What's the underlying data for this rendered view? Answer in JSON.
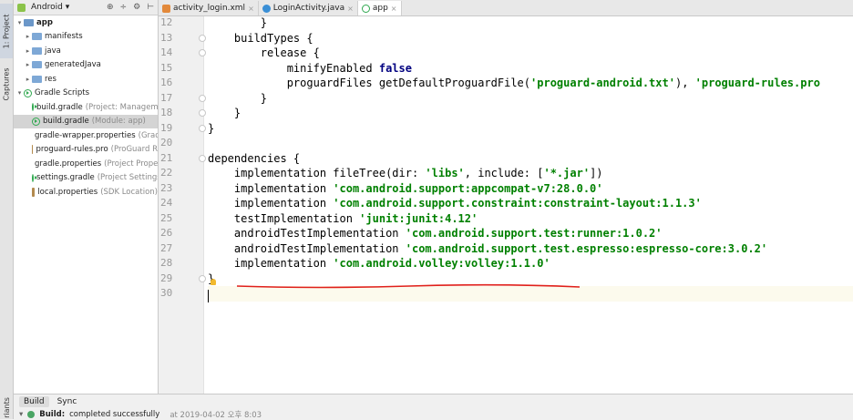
{
  "toolstrip": {
    "project_tab": "1: Project",
    "captures_tab": "Captures",
    "variants_tab": "riants"
  },
  "project_panel": {
    "view_selector": "Android",
    "tree": [
      {
        "label": "app",
        "secondary": "",
        "type": "folder-app",
        "arrow": "▾",
        "indent": 0,
        "selected": false,
        "bold": true
      },
      {
        "label": "manifests",
        "secondary": "",
        "type": "folder",
        "arrow": "▸",
        "indent": 1,
        "selected": false,
        "bold": false
      },
      {
        "label": "java",
        "secondary": "",
        "type": "folder",
        "arrow": "▸",
        "indent": 1,
        "selected": false,
        "bold": false
      },
      {
        "label": "generatedJava",
        "secondary": "",
        "type": "folder",
        "arrow": "▸",
        "indent": 1,
        "selected": false,
        "bold": false
      },
      {
        "label": "res",
        "secondary": "",
        "type": "folder",
        "arrow": "▸",
        "indent": 1,
        "selected": false,
        "bold": false
      },
      {
        "label": "Gradle Scripts",
        "secondary": "",
        "type": "gradle",
        "arrow": "▾",
        "indent": 0,
        "selected": false,
        "bold": false
      },
      {
        "label": "build.gradle",
        "secondary": "(Project: Managem",
        "type": "gradle",
        "arrow": "",
        "indent": 2,
        "selected": false,
        "bold": false
      },
      {
        "label": "build.gradle",
        "secondary": "(Module: app)",
        "type": "gradle",
        "arrow": "",
        "indent": 2,
        "selected": true,
        "bold": false
      },
      {
        "label": "gradle-wrapper.properties",
        "secondary": "(Grad",
        "type": "props",
        "arrow": "",
        "indent": 2,
        "selected": false,
        "bold": false
      },
      {
        "label": "proguard-rules.pro",
        "secondary": "(ProGuard R",
        "type": "props",
        "arrow": "",
        "indent": 2,
        "selected": false,
        "bold": false
      },
      {
        "label": "gradle.properties",
        "secondary": "(Project Prope",
        "type": "props",
        "arrow": "",
        "indent": 2,
        "selected": false,
        "bold": false
      },
      {
        "label": "settings.gradle",
        "secondary": "(Project Settings",
        "type": "gradle",
        "arrow": "",
        "indent": 2,
        "selected": false,
        "bold": false
      },
      {
        "label": "local.properties",
        "secondary": "(SDK Location)",
        "type": "props",
        "arrow": "",
        "indent": 2,
        "selected": false,
        "bold": false
      }
    ]
  },
  "editor_tabs": [
    {
      "label": "activity_login.xml",
      "icon": "xml-file-icon",
      "active": false
    },
    {
      "label": "LoginActivity.java",
      "icon": "java-class-icon",
      "active": false
    },
    {
      "label": "app",
      "icon": "gradle-icon",
      "active": true
    }
  ],
  "editor": {
    "lines": [
      {
        "num": "12",
        "tokens": [
          {
            "t": "        }",
            "c": ""
          }
        ]
      },
      {
        "num": "13",
        "tokens": [
          {
            "t": "    buildTypes {",
            "c": ""
          }
        ]
      },
      {
        "num": "14",
        "tokens": [
          {
            "t": "        release {",
            "c": ""
          }
        ]
      },
      {
        "num": "15",
        "tokens": [
          {
            "t": "            minifyEnabled ",
            "c": ""
          },
          {
            "t": "false",
            "c": "kw"
          }
        ]
      },
      {
        "num": "16",
        "tokens": [
          {
            "t": "            proguardFiles getDefaultProguardFile(",
            "c": ""
          },
          {
            "t": "'proguard-android.txt'",
            "c": "str"
          },
          {
            "t": "), ",
            "c": ""
          },
          {
            "t": "'proguard-rules.pro",
            "c": "str"
          }
        ]
      },
      {
        "num": "17",
        "tokens": [
          {
            "t": "        }",
            "c": ""
          }
        ]
      },
      {
        "num": "18",
        "tokens": [
          {
            "t": "    }",
            "c": ""
          }
        ]
      },
      {
        "num": "19",
        "tokens": [
          {
            "t": "}",
            "c": ""
          }
        ]
      },
      {
        "num": "20",
        "tokens": [
          {
            "t": "",
            "c": ""
          }
        ]
      },
      {
        "num": "21",
        "tokens": [
          {
            "t": "dependencies {",
            "c": ""
          }
        ]
      },
      {
        "num": "22",
        "tokens": [
          {
            "t": "    implementation fileTree(dir: ",
            "c": ""
          },
          {
            "t": "'libs'",
            "c": "str"
          },
          {
            "t": ", include: [",
            "c": ""
          },
          {
            "t": "'*.jar'",
            "c": "str"
          },
          {
            "t": "])",
            "c": ""
          }
        ]
      },
      {
        "num": "23",
        "tokens": [
          {
            "t": "    implementation ",
            "c": ""
          },
          {
            "t": "'com.android.support:appcompat-v7:28.0.0'",
            "c": "str"
          }
        ]
      },
      {
        "num": "24",
        "tokens": [
          {
            "t": "    implementation ",
            "c": ""
          },
          {
            "t": "'com.android.support.constraint:constraint-layout:1.1.3'",
            "c": "str"
          }
        ]
      },
      {
        "num": "25",
        "tokens": [
          {
            "t": "    testImplementation ",
            "c": ""
          },
          {
            "t": "'junit:junit:4.12'",
            "c": "str"
          }
        ]
      },
      {
        "num": "26",
        "tokens": [
          {
            "t": "    androidTestImplementation ",
            "c": ""
          },
          {
            "t": "'com.android.support.test:runner:1.0.2'",
            "c": "str"
          }
        ]
      },
      {
        "num": "27",
        "tokens": [
          {
            "t": "    androidTestImplementation ",
            "c": ""
          },
          {
            "t": "'com.android.support.test.espresso:espresso-core:3.0.2'",
            "c": "str"
          }
        ]
      },
      {
        "num": "28",
        "tokens": [
          {
            "t": "    implementation ",
            "c": ""
          },
          {
            "t": "'com.android.volley:volley:1.1.0'",
            "c": "str"
          }
        ]
      },
      {
        "num": "29",
        "tokens": [
          {
            "t": "}",
            "c": ""
          }
        ]
      },
      {
        "num": "30",
        "tokens": [
          {
            "t": "",
            "c": ""
          }
        ]
      }
    ],
    "current_line": "30",
    "underline_color": "#e0201b"
  },
  "build_panel": {
    "tabs": [
      {
        "label": "Build",
        "active": true
      },
      {
        "label": "Sync",
        "active": false
      }
    ],
    "status_label": "Build:",
    "status_text": "completed successfully",
    "timestamp": "at 2019-04-02 오후 8:03"
  },
  "colors": {
    "keyword": "#000080",
    "string": "#008000",
    "success": "#4aa564"
  }
}
